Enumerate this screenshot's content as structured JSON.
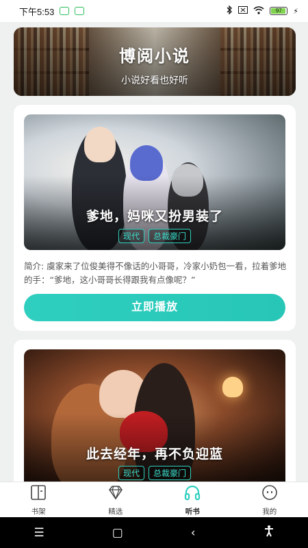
{
  "status_bar": {
    "time": "下午5:53",
    "battery": "97"
  },
  "banner": {
    "title": "博阅小说",
    "subtitle": "小说好看也好听"
  },
  "books": [
    {
      "title": "爹地，妈咪又扮男装了",
      "tags": [
        "现代",
        "总裁豪门"
      ],
      "description": "简介: 虞家来了位俊美得不像话的小哥哥，冷家小奶包一看，拉着爹地的手：“爹地，这小哥哥长得跟我有点像呢？”",
      "button": "立即播放"
    },
    {
      "title": "此去经年，再不负迎蓝",
      "tags": [
        "现代",
        "总裁豪门"
      ]
    }
  ],
  "tab_bar": {
    "items": [
      {
        "label": "书架",
        "icon": "bookshelf-icon"
      },
      {
        "label": "精选",
        "icon": "diamond-icon"
      },
      {
        "label": "听书",
        "icon": "headphones-icon",
        "active": true
      },
      {
        "label": "我的",
        "icon": "face-icon"
      }
    ],
    "accent": "#2fcfc0"
  },
  "system_nav": {
    "icons": [
      "menu-icon",
      "home-icon",
      "back-icon",
      "accessibility-icon"
    ]
  }
}
